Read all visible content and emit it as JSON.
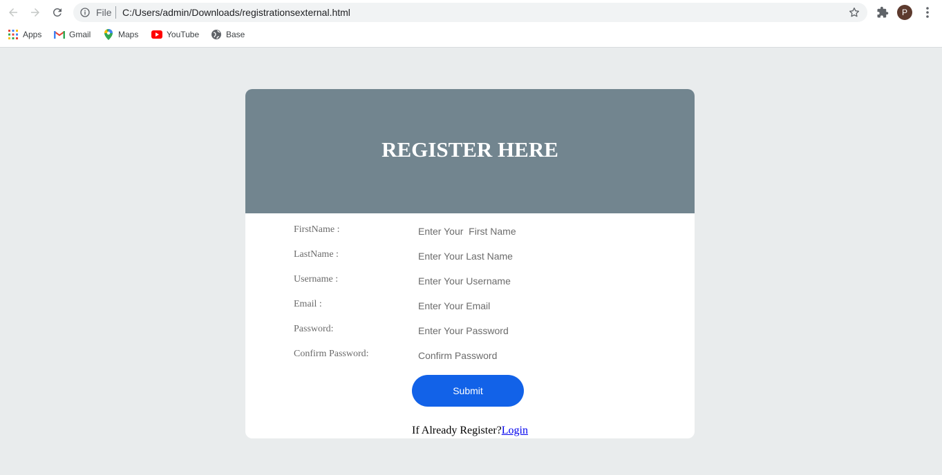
{
  "browser": {
    "address_scheme": "File",
    "address_url": "C:/Users/admin/Downloads/registrationsexternal.html",
    "profile_initial": "P",
    "bookmarks": [
      {
        "label": "Apps",
        "icon": "apps-grid-icon"
      },
      {
        "label": "Gmail",
        "icon": "gmail-icon"
      },
      {
        "label": "Maps",
        "icon": "maps-pin-icon"
      },
      {
        "label": "YouTube",
        "icon": "youtube-icon"
      },
      {
        "label": "Base",
        "icon": "globe-icon"
      }
    ]
  },
  "form": {
    "title": "REGISTER HERE",
    "fields": [
      {
        "label": "FirstName :",
        "placeholder": "Enter Your  First Name"
      },
      {
        "label": "LastName :",
        "placeholder": "Enter Your Last Name"
      },
      {
        "label": "Username :",
        "placeholder": "Enter Your Username"
      },
      {
        "label": "Email :",
        "placeholder": "Enter Your Email"
      },
      {
        "label": "Password:",
        "placeholder": "Enter Your Password"
      },
      {
        "label": "Confirm Password:",
        "placeholder": "Confirm Password"
      }
    ],
    "submit_label": "Submit",
    "login_prompt": "If Already Register?",
    "login_link": "Login"
  },
  "colors": {
    "page_bg": "#e9eced",
    "header_bg": "#72858f",
    "submit_bg": "#1262e8"
  }
}
